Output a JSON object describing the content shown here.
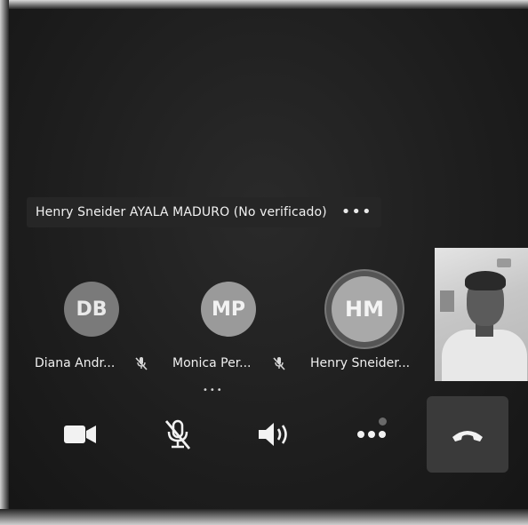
{
  "call": {
    "title": "Henry Sneider AYALA MADURO (No verificado)",
    "more_label": "•••"
  },
  "participants": [
    {
      "initials": "DB",
      "name": "Diana Andr...",
      "muted": true
    },
    {
      "initials": "MP",
      "name": "Monica Per...",
      "muted": true
    },
    {
      "initials": "HM",
      "name": "Henry Sneider...",
      "muted": false,
      "speaking": true
    }
  ],
  "toolbar": {
    "buttons": [
      {
        "icon": "video-camera-icon"
      },
      {
        "icon": "microphone-off-icon"
      },
      {
        "icon": "speaker-icon"
      },
      {
        "icon": "more-icon"
      },
      {
        "icon": "hang-up-icon"
      }
    ]
  },
  "colors": {
    "background": "#1d1d1d",
    "title_bar": "#262626",
    "avatar_db": "#7a7a7a",
    "avatar_mp": "#9a9a9a",
    "avatar_hm": "#a9a9a9",
    "hangup_bg": "#3a3a3a",
    "icon": "#f2f2f2"
  }
}
